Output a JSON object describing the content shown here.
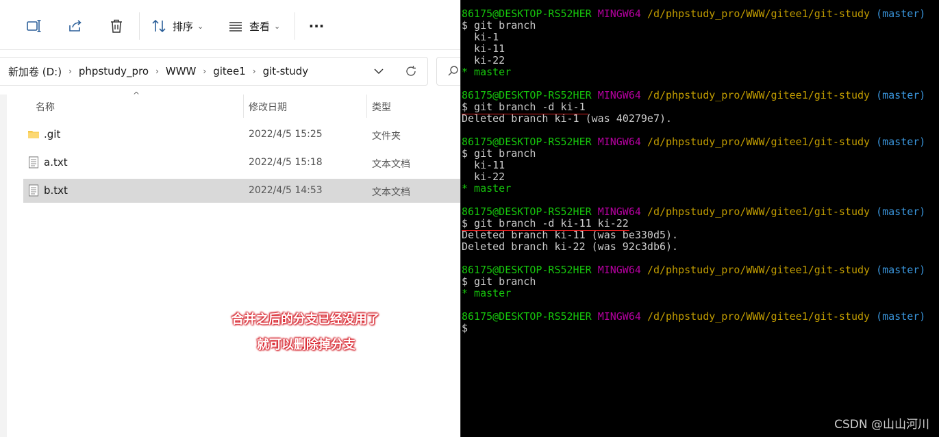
{
  "toolbar": {
    "sort_label": "排序",
    "view_label": "查看",
    "more_label": "···"
  },
  "address": {
    "crumbs": [
      "新加卷 (D:)",
      "phpstudy_pro",
      "WWW",
      "gitee1",
      "git-study"
    ]
  },
  "columns": {
    "name": "名称",
    "modified": "修改日期",
    "type": "类型"
  },
  "files": [
    {
      "name": ".git",
      "modified": "2022/4/5 15:25",
      "type": "文件夹",
      "icon": "folder-icon"
    },
    {
      "name": "a.txt",
      "modified": "2022/4/5 15:18",
      "type": "文本文档",
      "icon": "text-file-icon"
    },
    {
      "name": "b.txt",
      "modified": "2022/4/5 14:53",
      "type": "文本文档",
      "icon": "text-file-icon",
      "selected": true
    }
  ],
  "annotation": {
    "line1": "合并之后的分支已经没用了",
    "line2": "就可以删除掉分支"
  },
  "terminal": {
    "prompt_user": "86175@DESKTOP-RS52HER",
    "prompt_shell": "MINGW64",
    "prompt_path": "/d/phpstudy_pro/WWW/gitee1/git-study",
    "prompt_branch": "(master)",
    "lines": [
      {
        "kind": "prompt"
      },
      {
        "kind": "cmd",
        "text": "$ git branch"
      },
      {
        "kind": "out",
        "text": "  ki-1"
      },
      {
        "kind": "out",
        "text": "  ki-11"
      },
      {
        "kind": "out",
        "text": "  ki-22"
      },
      {
        "kind": "cur",
        "text": "* master"
      },
      {
        "kind": "blank",
        "text": ""
      },
      {
        "kind": "prompt"
      },
      {
        "kind": "cmd",
        "text": "$ git branch -d ki-1",
        "underline": true
      },
      {
        "kind": "out",
        "text": "Deleted branch ki-1 (was 40279e7)."
      },
      {
        "kind": "blank",
        "text": ""
      },
      {
        "kind": "prompt"
      },
      {
        "kind": "cmd",
        "text": "$ git branch"
      },
      {
        "kind": "out",
        "text": "  ki-11"
      },
      {
        "kind": "out",
        "text": "  ki-22"
      },
      {
        "kind": "cur",
        "text": "* master"
      },
      {
        "kind": "blank",
        "text": ""
      },
      {
        "kind": "prompt"
      },
      {
        "kind": "cmd",
        "text": "$ git branch -d ki-11 ki-22",
        "underline": true
      },
      {
        "kind": "out",
        "text": "Deleted branch ki-11 (was be330d5)."
      },
      {
        "kind": "out",
        "text": "Deleted branch ki-22 (was 92c3db6)."
      },
      {
        "kind": "blank",
        "text": ""
      },
      {
        "kind": "prompt"
      },
      {
        "kind": "cmd",
        "text": "$ git branch"
      },
      {
        "kind": "cur",
        "text": "* master"
      },
      {
        "kind": "blank",
        "text": ""
      },
      {
        "kind": "prompt"
      },
      {
        "kind": "cmd",
        "text": "$"
      }
    ]
  },
  "watermark": "CSDN @山山河川",
  "colors": {
    "prompt_user": "#16c60c",
    "prompt_shell": "#b4009e",
    "prompt_path": "#c19c00",
    "prompt_branch": "#3a96dd",
    "selected_row": "#d9d9d9",
    "annotation": "#e0202a"
  }
}
